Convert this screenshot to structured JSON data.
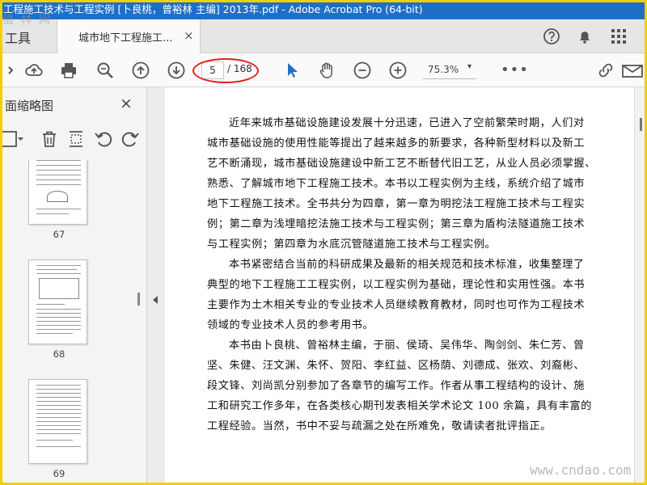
{
  "window": {
    "title": "工程施工技术与工程实例 [卜良桃，曾裕林 主编] 2013年.pdf - Adobe Acrobat Pro (64-bit)"
  },
  "watermarks": {
    "top_left": "值 林 网",
    "bottom_right": "www.cndao.com"
  },
  "tabbar": {
    "tools_label": "工具",
    "doc_tab_label": "城市地下工程施工...",
    "close_glyph": "×"
  },
  "toolbar": {
    "current_page": "5",
    "page_total": "/ 168",
    "zoom": "75.3%",
    "zoom_caret": "▾",
    "more": "•••"
  },
  "sidebar": {
    "title": "面缩略图",
    "close_glyph": "×",
    "options_caret": "▾",
    "thumbnails": [
      {
        "page": "67"
      },
      {
        "page": "68"
      },
      {
        "page": "69"
      }
    ]
  },
  "document": {
    "lines": [
      "近年来城市基础设施建设发展十分迅速，已进入了空前繁荣时期，人们对",
      "城市基础设施的使用性能等提出了越来越多的新要求，各种新型材料以及新工",
      "艺不断涌现，城市基础设施建设中新工艺不断替代旧工艺，从业人员必须掌握、",
      "熟悉、了解城市地下工程施工技术。本书以工程实例为主线，系统介绍了城市",
      "地下工程施工技术。全书共分为四章，第一章为明挖法工程施工技术与工程实",
      "例；第二章为浅埋暗挖法施工技术与工程实例；第三章为盾构法隧道施工技术",
      "与工程实例；第四章为水底沉管隧道施工技术与工程实例。",
      "本书紧密结合当前的科研成果及最新的相关规范和技术标准，收集整理了",
      "典型的地下工程施工工程实例，以工程实例为基础，理论性和实用性强。本书",
      "主要作为土木相关专业的专业技术人员继续教育教材，同时也可作为工程技术",
      "领域的专业技术人员的参考用书。",
      "本书由卜良桃、曾裕林主编，于丽、侯琦、吴伟华、陶剑剑、朱仁芳、曾",
      "坚、朱健、汪文渊、朱怀、贺阳、李红益、区杨荫、刘德成、张欢、刘裔彬、",
      "段文锋、刘尚凯分别参加了各章节的编写工作。作者从事工程结构的设计、施",
      "工和研究工作多年，在各类核心期刊发表相关学术论文 100 余篇，具有丰富的",
      "工程经验。当然，书中不妥与疏漏之处在所难免，敬请读者批评指正。"
    ]
  },
  "colors": {
    "titlebar": "#1e6fc8",
    "highlight_oval": "#e02020",
    "selection_tool": "#1e6fc8",
    "frame": "#f0d000"
  }
}
